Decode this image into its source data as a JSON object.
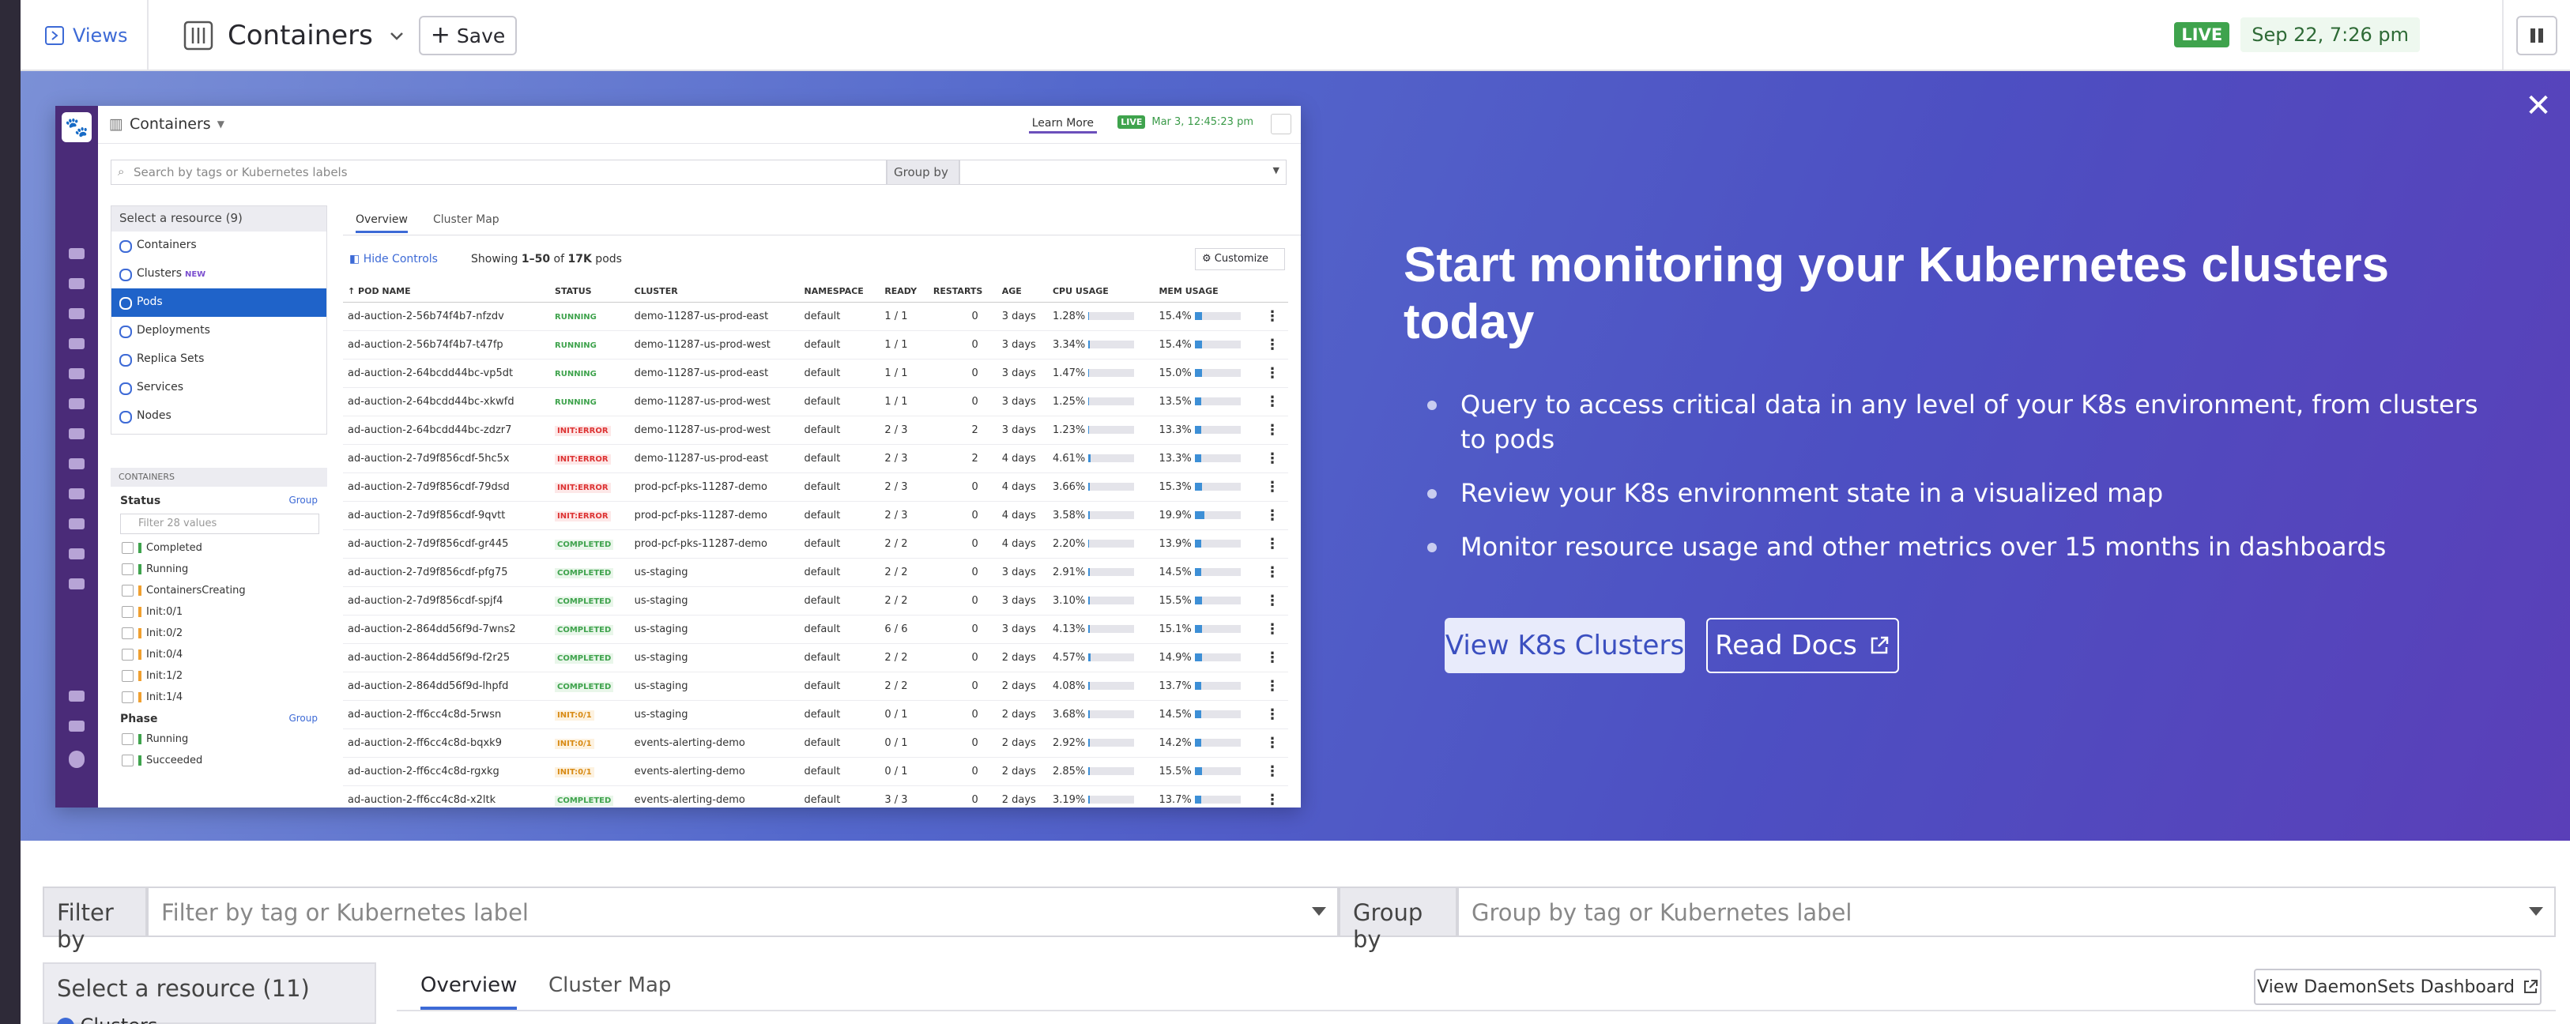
{
  "header": {
    "views_label": "Views",
    "title": "Containers",
    "save_label": "Save",
    "live_badge": "LIVE",
    "live_time": "Sep 22, 7:26 pm"
  },
  "banner": {
    "title": "Start monitoring your Kubernetes clusters today",
    "bullets": [
      "Query to access critical data in any level of your K8s environment, from clusters to pods",
      "Review your K8s environment state in a visualized map",
      "Monitor resource usage and other metrics over 15 months in dashboards"
    ],
    "primary_button": "View K8s Clusters",
    "secondary_button": "Read Docs",
    "preview": {
      "title": "Containers",
      "learn_more": "Learn More",
      "live_badge": "LIVE",
      "live_time": "Mar 3, 12:45:23 pm",
      "search_placeholder": "Search by tags or Kubernetes labels",
      "group_by": "Group by",
      "resource_header": "Select a resource (9)",
      "resources": [
        {
          "label": "Containers",
          "badge": ""
        },
        {
          "label": "Clusters",
          "badge": "NEW"
        },
        {
          "label": "Pods",
          "badge": ""
        },
        {
          "label": "Deployments",
          "badge": ""
        },
        {
          "label": "Replica Sets",
          "badge": ""
        },
        {
          "label": "Services",
          "badge": ""
        },
        {
          "label": "Nodes",
          "badge": ""
        }
      ],
      "facets_header": "CONTAINERS",
      "status_label": "Status",
      "group_link": "Group",
      "filter_placeholder": "Filter 28 values",
      "status_values": [
        {
          "label": "Completed",
          "color": "#3fa34d"
        },
        {
          "label": "Running",
          "color": "#3fa34d"
        },
        {
          "label": "ContainersCreating",
          "color": "#f0a030"
        },
        {
          "label": "Init:0/1",
          "color": "#f0a030"
        },
        {
          "label": "Init:0/2",
          "color": "#f0a030"
        },
        {
          "label": "Init:0/4",
          "color": "#f0a030"
        },
        {
          "label": "Init:1/2",
          "color": "#f0a030"
        },
        {
          "label": "Init:1/4",
          "color": "#f0a030"
        }
      ],
      "phase_label": "Phase",
      "phase_values": [
        {
          "label": "Running",
          "color": "#3fa34d"
        },
        {
          "label": "Succeeded",
          "color": "#3fa34d"
        }
      ],
      "tabs": [
        "Overview",
        "Cluster Map"
      ],
      "hide_controls": "Hide Controls",
      "showing_prefix": "Showing ",
      "showing_range": "1–50",
      "showing_mid": " of ",
      "showing_total": "17K",
      "showing_suffix": " pods",
      "customize": "Customize",
      "columns": [
        "POD NAME",
        "STATUS",
        "CLUSTER",
        "NAMESPACE",
        "READY",
        "RESTARTS",
        "AGE",
        "CPU USAGE",
        "MEM USAGE"
      ],
      "rows": [
        {
          "name": "ad-auction-2-56b74f4b7-nfzdv",
          "status": "RUNNING",
          "kind": "running",
          "cluster": "demo-11287-us-prod-east",
          "ns": "default",
          "ready": "1 / 1",
          "restarts": "0",
          "age": "3 days",
          "cpu": "1.28%",
          "cpu_v": 1.28,
          "mem": "15.4%",
          "mem_v": 15.4
        },
        {
          "name": "ad-auction-2-56b74f4b7-t47fp",
          "status": "RUNNING",
          "kind": "running",
          "cluster": "demo-11287-us-prod-west",
          "ns": "default",
          "ready": "1 / 1",
          "restarts": "0",
          "age": "3 days",
          "cpu": "3.34%",
          "cpu_v": 3.34,
          "mem": "15.4%",
          "mem_v": 15.4
        },
        {
          "name": "ad-auction-2-64bcdd44bc-vp5dt",
          "status": "RUNNING",
          "kind": "running",
          "cluster": "demo-11287-us-prod-east",
          "ns": "default",
          "ready": "1 / 1",
          "restarts": "0",
          "age": "3 days",
          "cpu": "1.47%",
          "cpu_v": 1.47,
          "mem": "15.0%",
          "mem_v": 15.0
        },
        {
          "name": "ad-auction-2-64bcdd44bc-xkwfd",
          "status": "RUNNING",
          "kind": "running",
          "cluster": "demo-11287-us-prod-west",
          "ns": "default",
          "ready": "1 / 1",
          "restarts": "0",
          "age": "3 days",
          "cpu": "1.25%",
          "cpu_v": 1.25,
          "mem": "13.5%",
          "mem_v": 13.5
        },
        {
          "name": "ad-auction-2-64bcdd44bc-zdzr7",
          "status": "INIT:ERROR",
          "kind": "error",
          "cluster": "demo-11287-us-prod-west",
          "ns": "default",
          "ready": "2 / 3",
          "restarts": "2",
          "age": "3 days",
          "cpu": "1.23%",
          "cpu_v": 1.23,
          "mem": "13.3%",
          "mem_v": 13.3
        },
        {
          "name": "ad-auction-2-7d9f856cdf-5hc5x",
          "status": "INIT:ERROR",
          "kind": "error",
          "cluster": "demo-11287-us-prod-east",
          "ns": "default",
          "ready": "2 / 3",
          "restarts": "2",
          "age": "4 days",
          "cpu": "4.61%",
          "cpu_v": 4.61,
          "mem": "13.3%",
          "mem_v": 13.3
        },
        {
          "name": "ad-auction-2-7d9f856cdf-79dsd",
          "status": "INIT:ERROR",
          "kind": "error",
          "cluster": "prod-pcf-pks-11287-demo",
          "ns": "default",
          "ready": "2 / 3",
          "restarts": "0",
          "age": "4 days",
          "cpu": "3.66%",
          "cpu_v": 3.66,
          "mem": "15.3%",
          "mem_v": 15.3
        },
        {
          "name": "ad-auction-2-7d9f856cdf-9qvtt",
          "status": "INIT:ERROR",
          "kind": "error",
          "cluster": "prod-pcf-pks-11287-demo",
          "ns": "default",
          "ready": "2 / 3",
          "restarts": "0",
          "age": "4 days",
          "cpu": "3.58%",
          "cpu_v": 3.58,
          "mem": "19.9%",
          "mem_v": 19.9
        },
        {
          "name": "ad-auction-2-7d9f856cdf-gr445",
          "status": "COMPLETED",
          "kind": "completed",
          "cluster": "prod-pcf-pks-11287-demo",
          "ns": "default",
          "ready": "2 / 2",
          "restarts": "0",
          "age": "4 days",
          "cpu": "2.20%",
          "cpu_v": 2.2,
          "mem": "13.9%",
          "mem_v": 13.9
        },
        {
          "name": "ad-auction-2-7d9f856cdf-pfg75",
          "status": "COMPLETED",
          "kind": "completed",
          "cluster": "us-staging",
          "ns": "default",
          "ready": "2 / 2",
          "restarts": "0",
          "age": "3 days",
          "cpu": "2.91%",
          "cpu_v": 2.91,
          "mem": "14.5%",
          "mem_v": 14.5
        },
        {
          "name": "ad-auction-2-7d9f856cdf-spjf4",
          "status": "COMPLETED",
          "kind": "completed",
          "cluster": "us-staging",
          "ns": "default",
          "ready": "2 / 2",
          "restarts": "0",
          "age": "3 days",
          "cpu": "3.10%",
          "cpu_v": 3.1,
          "mem": "15.5%",
          "mem_v": 15.5
        },
        {
          "name": "ad-auction-2-864dd56f9d-7wns2",
          "status": "COMPLETED",
          "kind": "completed",
          "cluster": "us-staging",
          "ns": "default",
          "ready": "6 / 6",
          "restarts": "0",
          "age": "3 days",
          "cpu": "4.13%",
          "cpu_v": 4.13,
          "mem": "15.1%",
          "mem_v": 15.1
        },
        {
          "name": "ad-auction-2-864dd56f9d-f2r25",
          "status": "COMPLETED",
          "kind": "completed",
          "cluster": "us-staging",
          "ns": "default",
          "ready": "2 / 2",
          "restarts": "0",
          "age": "2 days",
          "cpu": "4.57%",
          "cpu_v": 4.57,
          "mem": "14.9%",
          "mem_v": 14.9
        },
        {
          "name": "ad-auction-2-864dd56f9d-lhpfd",
          "status": "COMPLETED",
          "kind": "completed",
          "cluster": "us-staging",
          "ns": "default",
          "ready": "2 / 2",
          "restarts": "0",
          "age": "2 days",
          "cpu": "4.08%",
          "cpu_v": 4.08,
          "mem": "13.7%",
          "mem_v": 13.7
        },
        {
          "name": "ad-auction-2-ff6cc4c8d-5rwsn",
          "status": "INIT:0/1",
          "kind": "init",
          "cluster": "us-staging",
          "ns": "default",
          "ready": "0 / 1",
          "restarts": "0",
          "age": "2 days",
          "cpu": "3.68%",
          "cpu_v": 3.68,
          "mem": "14.5%",
          "mem_v": 14.5
        },
        {
          "name": "ad-auction-2-ff6cc4c8d-bqxk9",
          "status": "INIT:0/1",
          "kind": "init",
          "cluster": "events-alerting-demo",
          "ns": "default",
          "ready": "0 / 1",
          "restarts": "0",
          "age": "2 days",
          "cpu": "2.92%",
          "cpu_v": 2.92,
          "mem": "14.2%",
          "mem_v": 14.2
        },
        {
          "name": "ad-auction-2-ff6cc4c8d-rgxkg",
          "status": "INIT:0/1",
          "kind": "init",
          "cluster": "events-alerting-demo",
          "ns": "default",
          "ready": "0 / 1",
          "restarts": "0",
          "age": "2 days",
          "cpu": "2.85%",
          "cpu_v": 2.85,
          "mem": "15.5%",
          "mem_v": 15.5
        },
        {
          "name": "ad-auction-2-ff6cc4c8d-x2ltk",
          "status": "COMPLETED",
          "kind": "completed",
          "cluster": "events-alerting-demo",
          "ns": "default",
          "ready": "3 / 3",
          "restarts": "0",
          "age": "2 days",
          "cpu": "3.19%",
          "cpu_v": 3.19,
          "mem": "13.7%",
          "mem_v": 13.7
        }
      ]
    }
  },
  "filters": {
    "filter_label": "Filter by",
    "filter_placeholder": "Filter by tag or Kubernetes label",
    "group_label": "Group by",
    "group_placeholder": "Group by tag or Kubernetes label"
  },
  "resources": {
    "header": "Select a resource (11)",
    "first_item": "Clusters"
  },
  "main_tabs": [
    "Overview",
    "Cluster Map"
  ],
  "daemonsets_button": "View DaemonSets Dashboard",
  "colors": {
    "accent": "#3d6ad6",
    "live_green": "#3fa34d",
    "banner_start": "#7b90d6",
    "banner_end": "#5a3fb8",
    "preview_nav": "#4a2b78"
  }
}
